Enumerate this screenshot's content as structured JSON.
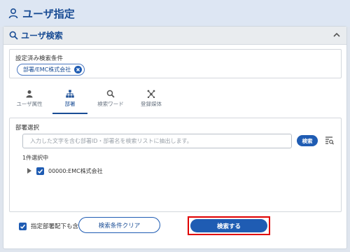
{
  "header": {
    "title": "ユーザ指定",
    "icon": "person-icon"
  },
  "panel": {
    "title": "ユーザ検索",
    "icon": "search-icon",
    "collapse_icon": "chevron-up-icon"
  },
  "conditions": {
    "label": "設定済み検索条件",
    "chip": "部署/EMC株式会社"
  },
  "tabs": [
    {
      "label": "ユーザ属性",
      "icon": "person-icon",
      "active": false
    },
    {
      "label": "部署",
      "icon": "org-chart-icon",
      "active": true
    },
    {
      "label": "検索ワード",
      "icon": "search-icon",
      "active": false
    },
    {
      "label": "登録媒体",
      "icon": "network-icon",
      "active": false
    }
  ],
  "department": {
    "label": "部署選択",
    "input_placeholder": "入力した文字を含む部署ID・部署名を検索リストに抽出します。",
    "search_button": "検索",
    "selected_count": "1件選択中",
    "tree_item": "00000:EMC株式会社",
    "tree_item_checked": true
  },
  "include_sub": {
    "label": "指定部署配下も含む",
    "checked": true
  },
  "buttons": {
    "clear": "検索条件クリア",
    "submit": "検索する"
  },
  "colors": {
    "accent": "#1f5cb3",
    "title": "#1a4d95",
    "highlight": "#e00000"
  }
}
